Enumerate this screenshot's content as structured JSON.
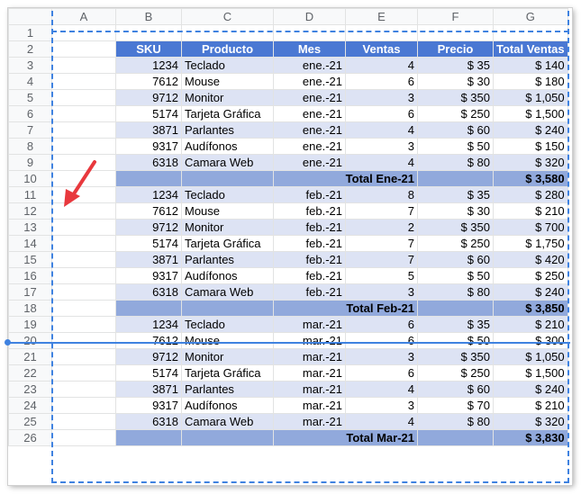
{
  "sheet": {
    "column_letters": [
      "A",
      "B",
      "C",
      "D",
      "E",
      "F",
      "G"
    ],
    "headers": [
      "SKU",
      "Producto",
      "Mes",
      "Ventas",
      "Precio",
      "Total Ventas"
    ],
    "rows": [
      {
        "num": "1",
        "type": "blank"
      },
      {
        "num": "2",
        "type": "header"
      },
      {
        "num": "3",
        "type": "data",
        "cells": [
          "1234",
          "Teclado",
          "ene.-21",
          "4",
          "$ 35",
          "$ 140"
        ]
      },
      {
        "num": "4",
        "type": "data",
        "cells": [
          "7612",
          "Mouse",
          "ene.-21",
          "6",
          "$ 30",
          "$ 180"
        ]
      },
      {
        "num": "5",
        "type": "data",
        "cells": [
          "9712",
          "Monitor",
          "ene.-21",
          "3",
          "$ 350",
          "$ 1,050"
        ]
      },
      {
        "num": "6",
        "type": "data",
        "cells": [
          "5174",
          "Tarjeta Gráfica",
          "ene.-21",
          "6",
          "$ 250",
          "$ 1,500"
        ]
      },
      {
        "num": "7",
        "type": "data",
        "cells": [
          "3871",
          "Parlantes",
          "ene.-21",
          "4",
          "$ 60",
          "$ 240"
        ]
      },
      {
        "num": "8",
        "type": "data",
        "cells": [
          "9317",
          "Audífonos",
          "ene.-21",
          "3",
          "$ 50",
          "$ 150"
        ]
      },
      {
        "num": "9",
        "type": "data",
        "cells": [
          "6318",
          "Camara Web",
          "ene.-21",
          "4",
          "$ 80",
          "$ 320"
        ]
      },
      {
        "num": "10",
        "type": "total",
        "label": "Total Ene-21",
        "value": "$ 3,580"
      },
      {
        "num": "11",
        "type": "data",
        "cells": [
          "1234",
          "Teclado",
          "feb.-21",
          "8",
          "$ 35",
          "$ 280"
        ]
      },
      {
        "num": "12",
        "type": "data",
        "cells": [
          "7612",
          "Mouse",
          "feb.-21",
          "7",
          "$ 30",
          "$ 210"
        ]
      },
      {
        "num": "13",
        "type": "data",
        "cells": [
          "9712",
          "Monitor",
          "feb.-21",
          "2",
          "$ 350",
          "$ 700"
        ]
      },
      {
        "num": "14",
        "type": "data",
        "cells": [
          "5174",
          "Tarjeta Gráfica",
          "feb.-21",
          "7",
          "$ 250",
          "$ 1,750"
        ]
      },
      {
        "num": "15",
        "type": "data",
        "cells": [
          "3871",
          "Parlantes",
          "feb.-21",
          "7",
          "$ 60",
          "$ 420"
        ]
      },
      {
        "num": "16",
        "type": "data",
        "cells": [
          "9317",
          "Audífonos",
          "feb.-21",
          "5",
          "$ 50",
          "$ 250"
        ]
      },
      {
        "num": "17",
        "type": "data",
        "cells": [
          "6318",
          "Camara Web",
          "feb.-21",
          "3",
          "$ 80",
          "$ 240"
        ]
      },
      {
        "num": "18",
        "type": "total",
        "label": "Total Feb-21",
        "value": "$ 3,850"
      },
      {
        "num": "19",
        "type": "data",
        "cells": [
          "1234",
          "Teclado",
          "mar.-21",
          "6",
          "$ 35",
          "$ 210"
        ]
      },
      {
        "num": "20",
        "type": "data",
        "cells": [
          "7612",
          "Mouse",
          "mar.-21",
          "6",
          "$ 50",
          "$ 300"
        ]
      },
      {
        "num": "21",
        "type": "data",
        "cells": [
          "9712",
          "Monitor",
          "mar.-21",
          "3",
          "$ 350",
          "$ 1,050"
        ]
      },
      {
        "num": "22",
        "type": "data",
        "cells": [
          "5174",
          "Tarjeta Gráfica",
          "mar.-21",
          "6",
          "$ 250",
          "$ 1,500"
        ]
      },
      {
        "num": "23",
        "type": "data",
        "cells": [
          "3871",
          "Parlantes",
          "mar.-21",
          "4",
          "$ 60",
          "$ 240"
        ]
      },
      {
        "num": "24",
        "type": "data",
        "cells": [
          "9317",
          "Audífonos",
          "mar.-21",
          "3",
          "$ 70",
          "$ 210"
        ]
      },
      {
        "num": "25",
        "type": "data",
        "cells": [
          "6318",
          "Camara Web",
          "mar.-21",
          "4",
          "$ 80",
          "$ 320"
        ]
      },
      {
        "num": "26",
        "type": "total",
        "label": "Total Mar-21",
        "value": "$ 3,830"
      }
    ]
  },
  "colors": {
    "header_fill": "#4a78d3",
    "band_fill": "#dde3f4",
    "total_fill": "#91a9dc",
    "page_break": "#3f82e0",
    "arrow": "#e8383d"
  },
  "icons": {
    "annotation": "arrow-icon",
    "page_break_handle": "drag-handle-icon"
  }
}
